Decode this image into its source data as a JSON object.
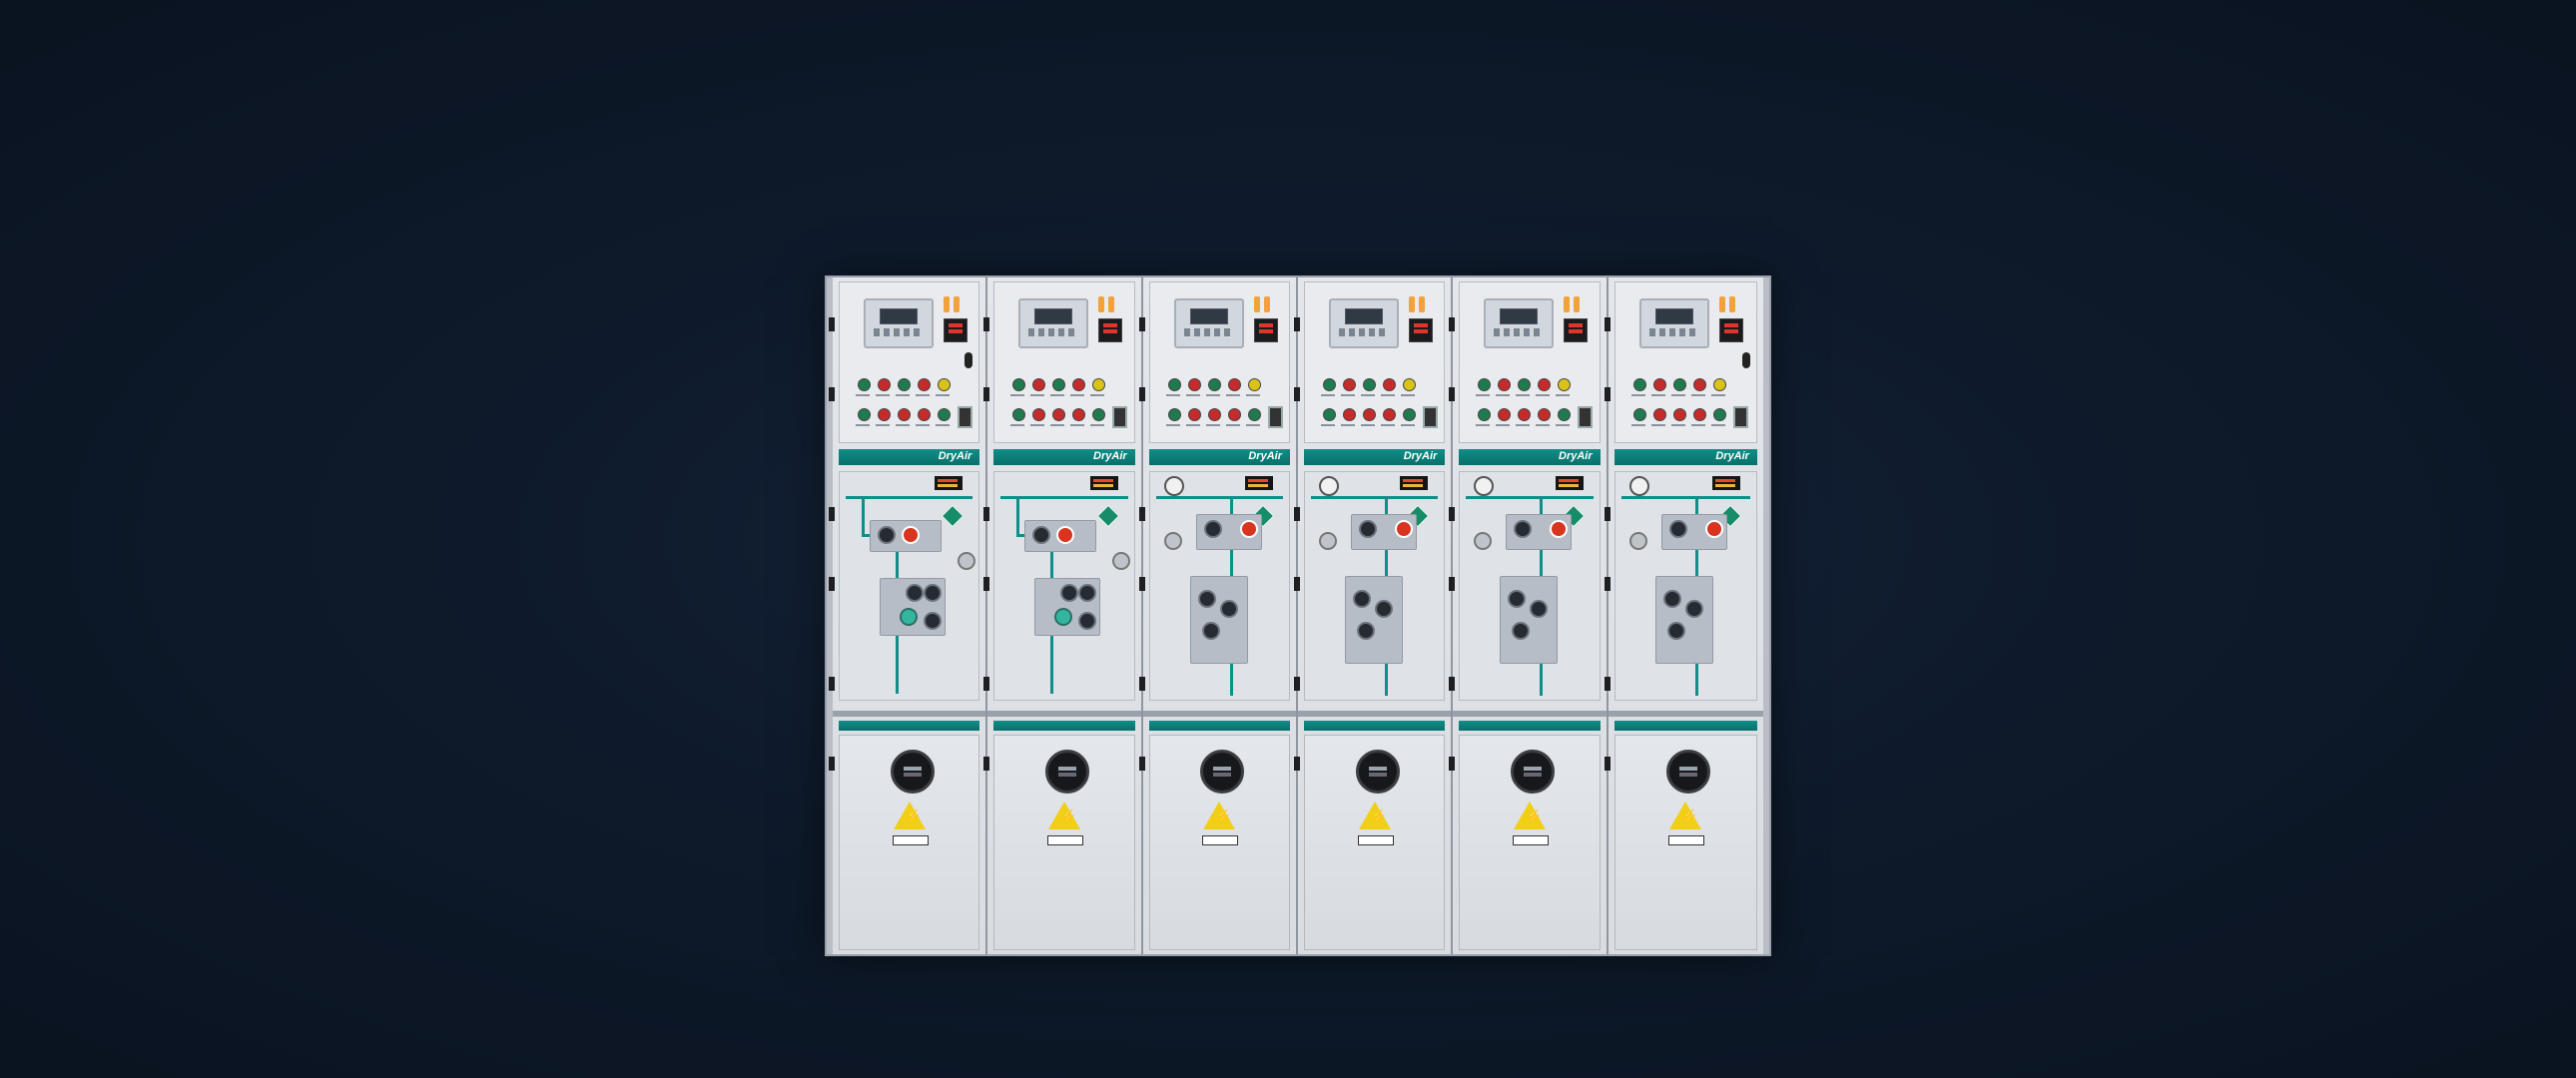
{
  "scene": {
    "background_color": "#0e1a2b",
    "accent_color": "#0f8f88",
    "warning_color": "#f0cf16"
  },
  "switchgear": {
    "brand_text": "DryAir",
    "units": [
      {
        "id": "unit-1",
        "type": "load-break"
      },
      {
        "id": "unit-2",
        "type": "load-break"
      },
      {
        "id": "unit-3",
        "type": "circuit-breaker"
      },
      {
        "id": "unit-4",
        "type": "circuit-breaker"
      },
      {
        "id": "unit-5",
        "type": "circuit-breaker"
      },
      {
        "id": "unit-6",
        "type": "circuit-breaker"
      }
    ],
    "icons": {
      "hazard": "lightning-warning-icon",
      "indicator": "voltage-indicator-icon",
      "gauge": "pressure-gauge-icon"
    }
  }
}
